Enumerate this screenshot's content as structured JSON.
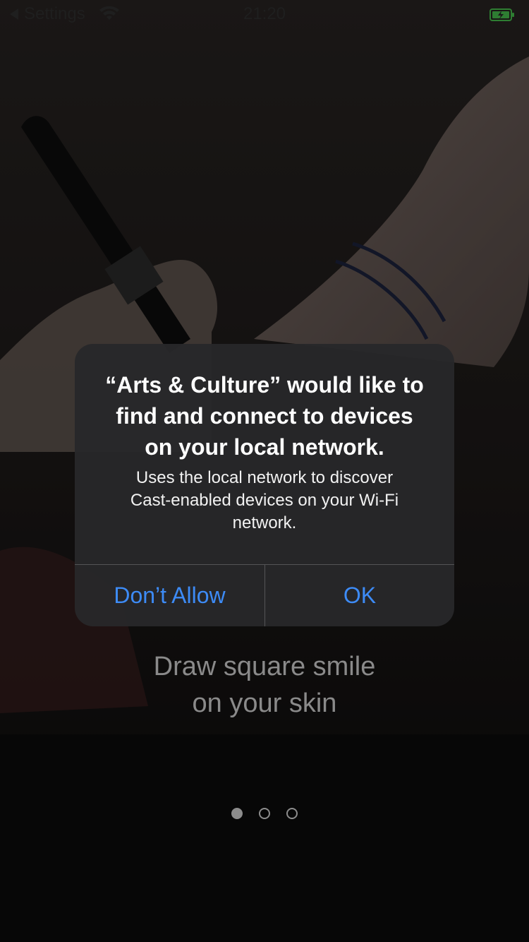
{
  "status_bar": {
    "back_label": "Settings",
    "time": "21:20"
  },
  "alert": {
    "title_lines": [
      "“Arts & Culture” would like to",
      "find and connect to devices",
      "on your local network."
    ],
    "message_lines": [
      "Uses the local network to discover",
      "Cast-enabled devices on your Wi-Fi",
      "network."
    ],
    "dont_allow_label": "Don’t Allow",
    "ok_label": "OK"
  },
  "onboarding": {
    "caption_lines": [
      "Draw square smile",
      "on your skin"
    ],
    "page_count": 3,
    "current_page": 1
  },
  "colors": {
    "accent": "#3d8bf6",
    "alert_background": "#28282a",
    "battery": "#2e7d32"
  },
  "icons": {
    "back": "back-triangle-icon",
    "wifi": "wifi-icon",
    "battery": "battery-charging-icon"
  }
}
